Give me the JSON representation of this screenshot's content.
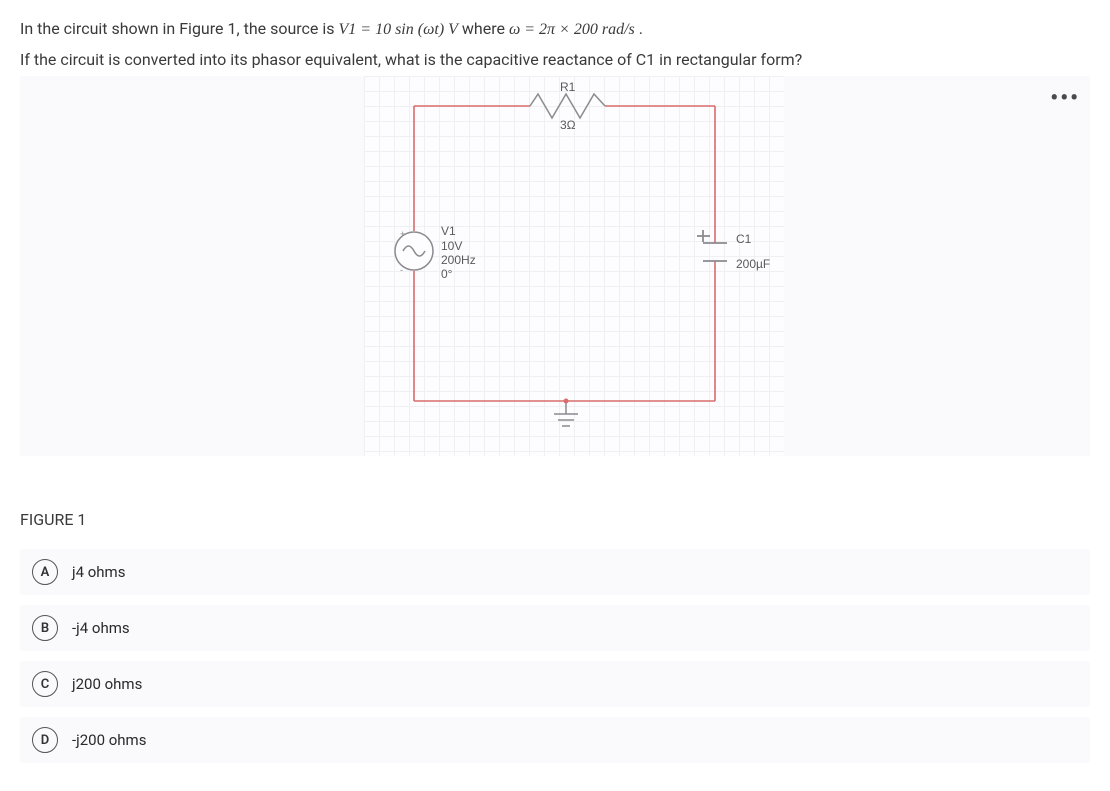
{
  "question": {
    "line1_prefix": "In the circuit shown in Figure 1, the source is ",
    "formula1": "V1 = 10 sin (ωt)  V",
    "line1_mid": " where ",
    "formula2": "ω = 2π × 200 rad/s",
    "line1_suffix": ".",
    "line2": "If the circuit is converted into its phasor equivalent, what is the capacitive reactance of C1 in rectangular form?"
  },
  "figure": {
    "caption": "FIGURE 1",
    "r1_name": "R1",
    "r1_value": "3Ω",
    "v1_name": "V1",
    "v1_line1": "10V",
    "v1_line2": "200Hz",
    "v1_line3": "0°",
    "c1_name": "C1",
    "c1_value": "200µF",
    "dots": "•••"
  },
  "options": [
    {
      "letter": "A",
      "text": "j4 ohms"
    },
    {
      "letter": "B",
      "text": "-j4 ohms"
    },
    {
      "letter": "C",
      "text": "j200 ohms"
    },
    {
      "letter": "D",
      "text": "-j200 ohms"
    }
  ]
}
